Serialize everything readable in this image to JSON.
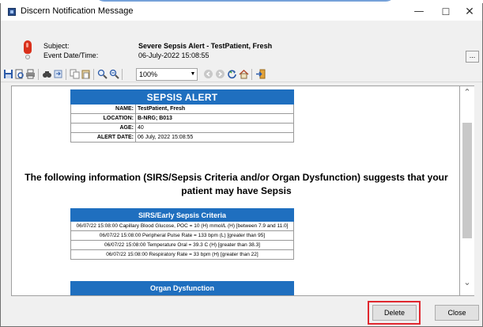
{
  "window": {
    "title": "Discern Notification Message",
    "controls": {
      "minimize": "—",
      "maximize": "☐",
      "close": "✕"
    }
  },
  "header": {
    "subject_label": "Subject:",
    "subject_value": "Severe Sepsis Alert - TestPatient, Fresh",
    "event_label": "Event Date/Time:",
    "event_value": "06-July-2022 15:08:55",
    "more_button": "..."
  },
  "toolbar": {
    "zoom_value": "100%",
    "icons": [
      "save-icon",
      "print-preview-icon",
      "print-icon",
      "find-icon",
      "find-next-icon",
      "copy-icon",
      "paste-icon",
      "zoom-in-icon",
      "zoom-out-icon",
      "back-icon",
      "forward-icon",
      "refresh-icon",
      "home-icon",
      "exit-icon"
    ]
  },
  "alert": {
    "title": "SEPSIS ALERT",
    "rows": [
      {
        "label": "NAME:",
        "value": "TestPatient, Fresh",
        "bold": true
      },
      {
        "label": "LOCATION:",
        "value": "B-NRG; B013",
        "bold": true
      },
      {
        "label": "AGE:",
        "value": "40",
        "bold": false
      },
      {
        "label": "ALERT DATE:",
        "value": "06 July, 2022 15:08:55",
        "bold": false
      }
    ]
  },
  "message": {
    "line1": "The following information (SIRS/Sepsis Criteria and/or Organ Dysfunction) suggests that your",
    "line2": "patient may have Sepsis"
  },
  "criteria": {
    "title": "SIRS/Early Sepsis Criteria",
    "rows": [
      "06/07/22 15:08:00 Capillary Blood Glucose, POC = 10 (H) mmol/L (H) [between 7.9 and 11.0]",
      "06/07/22 15:08:00 Peripheral Pulse Rate = 133 bpm (L) [greater than 95]",
      "06/07/22 15:08:00 Temperature Oral = 39.3 C (H) [greater than 38.3]",
      "06/07/22 15:08:00 Respiratory Rate = 33 bpm (H) [greater than 22]"
    ]
  },
  "organ": {
    "title": "Organ Dysfunction"
  },
  "footer": {
    "delete_label": "Delete",
    "close_label": "Close"
  },
  "colors": {
    "alert_header": "#1f6fbf",
    "highlight": "#e0282f"
  }
}
